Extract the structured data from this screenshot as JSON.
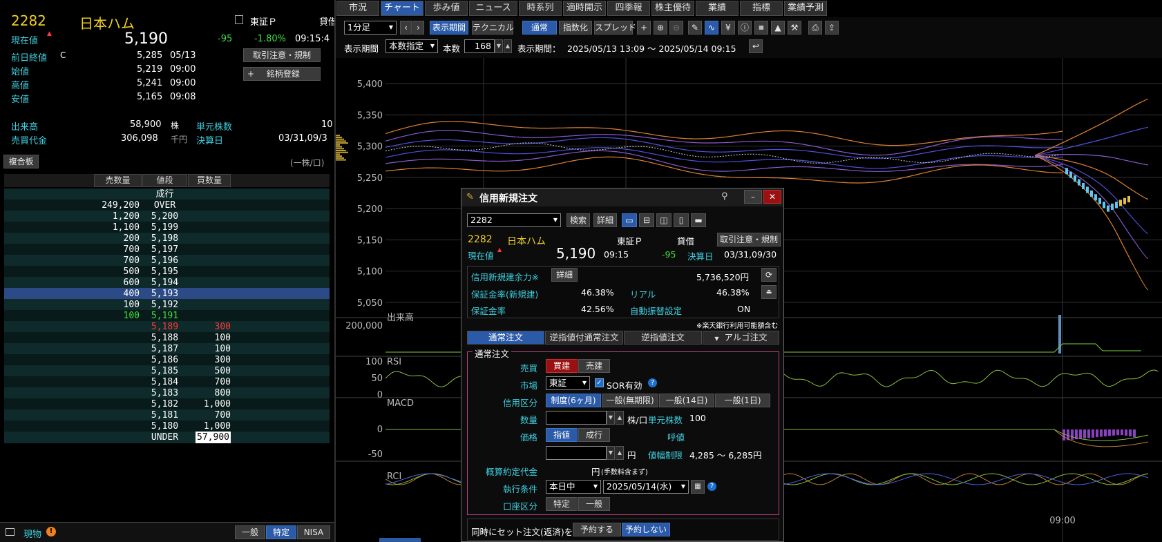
{
  "stock": {
    "code": "2282",
    "name": "日本ハム",
    "market": "東証Ｐ",
    "lending": "貸借",
    "price_label": "現在値",
    "price": "5,190",
    "change": "-95",
    "change_pct": "-1.80%",
    "time": "09:15:4"
  },
  "quote": {
    "prev_close_label": "前日終値",
    "prev_close_flag": "C",
    "prev_close": "5,285",
    "prev_close_date": "05/13",
    "open_label": "始値",
    "open": "5,219",
    "open_time": "09:00",
    "high_label": "高値",
    "high": "5,241",
    "high_time": "09:00",
    "low_label": "安値",
    "low": "5,165",
    "low_time": "09:08",
    "volume_label": "出来高",
    "volume": "58,900",
    "volume_unit": "株",
    "turnover_label": "売買代金",
    "turnover": "306,098",
    "turnover_unit": "千円",
    "unit_shares_label": "単元株数",
    "unit_shares": "10",
    "settle_label": "決算日",
    "settle": "03/31,09/3"
  },
  "left_buttons": {
    "notice": "取引注意・規制",
    "register": "銘柄登録",
    "register_plus": "+"
  },
  "orderbook": {
    "button": "複合板",
    "unit_note": "(一株/口)",
    "headers": [
      "売数量",
      "値段",
      "買数量"
    ],
    "rows": [
      {
        "sell": "",
        "price": "成行",
        "buy": ""
      },
      {
        "sell": "249,200",
        "price": "OVER",
        "buy": ""
      },
      {
        "sell": "1,200",
        "price": "5,200",
        "buy": ""
      },
      {
        "sell": "1,100",
        "price": "5,199",
        "buy": ""
      },
      {
        "sell": "200",
        "price": "5,198",
        "buy": ""
      },
      {
        "sell": "700",
        "price": "5,197",
        "buy": ""
      },
      {
        "sell": "700",
        "price": "5,196",
        "buy": ""
      },
      {
        "sell": "500",
        "price": "5,195",
        "buy": ""
      },
      {
        "sell": "600",
        "price": "5,194",
        "buy": ""
      },
      {
        "sell": "400",
        "price": "5,193",
        "buy": ""
      },
      {
        "sell": "100",
        "price": "5,192",
        "buy": ""
      },
      {
        "sell": "100",
        "price": "5,191",
        "buy": ""
      },
      {
        "sell": "",
        "price": "5,189",
        "buy": "300"
      },
      {
        "sell": "",
        "price": "5,188",
        "buy": "100"
      },
      {
        "sell": "",
        "price": "5,187",
        "buy": "100"
      },
      {
        "sell": "",
        "price": "5,186",
        "buy": "300"
      },
      {
        "sell": "",
        "price": "5,185",
        "buy": "500"
      },
      {
        "sell": "",
        "price": "5,184",
        "buy": "700"
      },
      {
        "sell": "",
        "price": "5,183",
        "buy": "800"
      },
      {
        "sell": "",
        "price": "5,182",
        "buy": "1,000"
      },
      {
        "sell": "",
        "price": "5,181",
        "buy": "700"
      },
      {
        "sell": "",
        "price": "5,180",
        "buy": "1,000"
      },
      {
        "sell": "",
        "price": "UNDER",
        "buy": "57,900"
      }
    ]
  },
  "bottom_left": {
    "label": "現物",
    "tabs": [
      "一般",
      "特定",
      "NISA"
    ]
  },
  "top_tabs": [
    "市況",
    "チャート",
    "歩み値",
    "ニュース",
    "時系列",
    "適時開示",
    "四季報",
    "株主優待",
    "業績",
    "指標",
    "業績予測"
  ],
  "toolbar": {
    "interval": "1分足",
    "display_period": "表示期間",
    "technical": "テクニカル",
    "normal": "通常",
    "indexed": "指数化",
    "spread": "スプレッド",
    "period_label": "表示期間",
    "bars_mode": "本数指定",
    "bars_label": "本数",
    "bars": "168",
    "period_range_label": "表示期間：",
    "period_range": "2025/05/13 13:09 ～ 2025/05/14 09:15"
  },
  "chart_data": {
    "type": "line",
    "y_ticks": [
      "5,400",
      "5,350",
      "5,300",
      "5,250",
      "5,200",
      "5,150",
      "5,100",
      "5,050"
    ],
    "ylim": [
      5030,
      5410
    ],
    "volume_label": "出来高",
    "volume_tick": "200,000",
    "rsi_label": "RSI",
    "rsi_ticks": [
      "100",
      "50",
      "0"
    ],
    "macd_label": "MACD",
    "macd_ticks": [
      "0",
      "-50"
    ],
    "rci_label": "RCI",
    "x_tick": "09:00"
  },
  "dialog": {
    "title": "信用新規注文",
    "code_value": "2282",
    "search": "検索",
    "detail": "詳細",
    "code": "2282",
    "name": "日本ハム",
    "market": "東証Ｐ",
    "lending": "貸借",
    "notice": "取引注意・規制",
    "price_label": "現在値",
    "price": "5,190",
    "time": "09:15",
    "change": "-95",
    "settle_label": "決算日",
    "settle": "03/31,09/30",
    "margin_capacity_label": "信用新規建余力※",
    "margin_detail": "詳細",
    "margin_capacity": "5,736,520円",
    "deposit_rate_new_label": "保証金率(新規建)",
    "deposit_rate_new": "46.38%",
    "real_label": "リアル",
    "real": "46.38%",
    "deposit_rate_label": "保証金率",
    "deposit_rate": "42.56%",
    "auto_transfer_label": "自動振替設定",
    "auto_transfer": "ON",
    "bank_note": "※楽天銀行利用可能額含む",
    "order_tabs": [
      "通常注文",
      "逆指値付通常注文",
      "逆指値注文",
      "アルゴ注文"
    ],
    "group_title": "通常注文",
    "side_label": "売買",
    "buy": "買建",
    "sell": "売建",
    "market_label": "市場",
    "market_value": "東証",
    "sor": "SOR有効",
    "credit_type_label": "信用区分",
    "credit_types": [
      "制度(6ヶ月)",
      "一般(無期限)",
      "一般(14日)",
      "一般(1日)"
    ],
    "qty_label": "数量",
    "qty_unit": "株/口",
    "unit_shares_label": "単元株数",
    "unit_shares": "100",
    "price_type_label": "価格",
    "limit": "指値",
    "market_order": "成行",
    "tick_label": "呼値",
    "yen": "円",
    "price_limit_label": "値幅制限",
    "price_limit": "4,285 ～ 6,285円",
    "estimate_label": "概算約定代金",
    "estimate_unit": "円",
    "estimate_note": "(手数料含まず)",
    "exec_label": "執行条件",
    "exec_value": "本日中",
    "date_value": "2025/05/14(水)",
    "account_label": "口座区分",
    "account_specific": "特定",
    "account_general": "一般",
    "set_order_label": "同時にセット注文(返済)を",
    "set_yes": "予約する",
    "set_no": "予約しない"
  }
}
